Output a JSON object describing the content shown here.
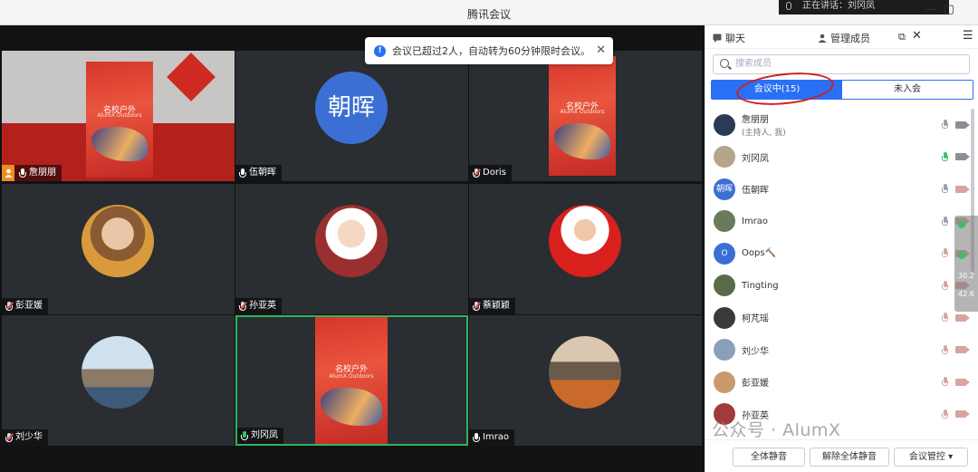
{
  "window": {
    "title": "腾讯会议",
    "speaking_text": "正在讲话：刘冈凤"
  },
  "notice": {
    "text": "会议已超过2人，自动转为60分钟限时会议。"
  },
  "poster": {
    "title": "名校户外",
    "subtitle": "AlumX Outdoors"
  },
  "tiles": [
    {
      "name": "詹朋朋",
      "mic": "on",
      "host": true
    },
    {
      "name": "伍朝晖",
      "mic": "on",
      "avatar_text": "朝晖"
    },
    {
      "name": "Doris",
      "mic": "muted"
    },
    {
      "name": "彭亚媛",
      "mic": "muted"
    },
    {
      "name": "孙亚英",
      "mic": "muted"
    },
    {
      "name": "蔡颖颖",
      "mic": "muted"
    },
    {
      "name": "刘少华",
      "mic": "muted"
    },
    {
      "name": "刘冈凤",
      "mic": "green",
      "active": true
    },
    {
      "name": "Imrao",
      "mic": "on"
    }
  ],
  "panel": {
    "tab_chat": "聊天",
    "tab_members": "管理成员",
    "search_placeholder": "搜索成员",
    "in_meeting": "会议中(15)",
    "not_joined": "未入会",
    "members": [
      {
        "name": "詹朋朋",
        "sub": "(主持人, 我)",
        "mic": "on",
        "cam": "on",
        "avatar_color": "#2b3a55"
      },
      {
        "name": "刘冈凤",
        "mic": "green",
        "cam": "on",
        "avatar_color": "#b5a58a"
      },
      {
        "name": "伍朝晖",
        "mic": "on",
        "cam": "off",
        "avatar_text": "朝晖",
        "avatar_color": "#3b6fd4"
      },
      {
        "name": "Imrao",
        "mic": "on",
        "cam": "off",
        "avatar_color": "#6b7a5a"
      },
      {
        "name": "Oops🔨",
        "mic": "muted",
        "cam": "off",
        "avatar_text": "O",
        "avatar_color": "#3b6fd4"
      },
      {
        "name": "Tingting",
        "mic": "muted",
        "cam": "off",
        "avatar_color": "#5a6b4a"
      },
      {
        "name": "柯芃瑶",
        "mic": "muted",
        "cam": "off",
        "avatar_color": "#3a3a3a"
      },
      {
        "name": "刘少华",
        "mic": "muted",
        "cam": "off",
        "avatar_color": "#8aa0b8"
      },
      {
        "name": "彭亚媛",
        "mic": "muted",
        "cam": "off",
        "avatar_color": "#c99a6b"
      },
      {
        "name": "孙亚英",
        "mic": "muted",
        "cam": "off",
        "avatar_color": "#a33a3a"
      }
    ],
    "footer": {
      "mute_all": "全体静音",
      "unmute_all": "解除全体静音",
      "meeting_control": "会议管控 ▾"
    }
  },
  "side_widget": {
    "v1": "30.2",
    "v2": "42.6"
  },
  "watermark": "公众号 · AlumX"
}
